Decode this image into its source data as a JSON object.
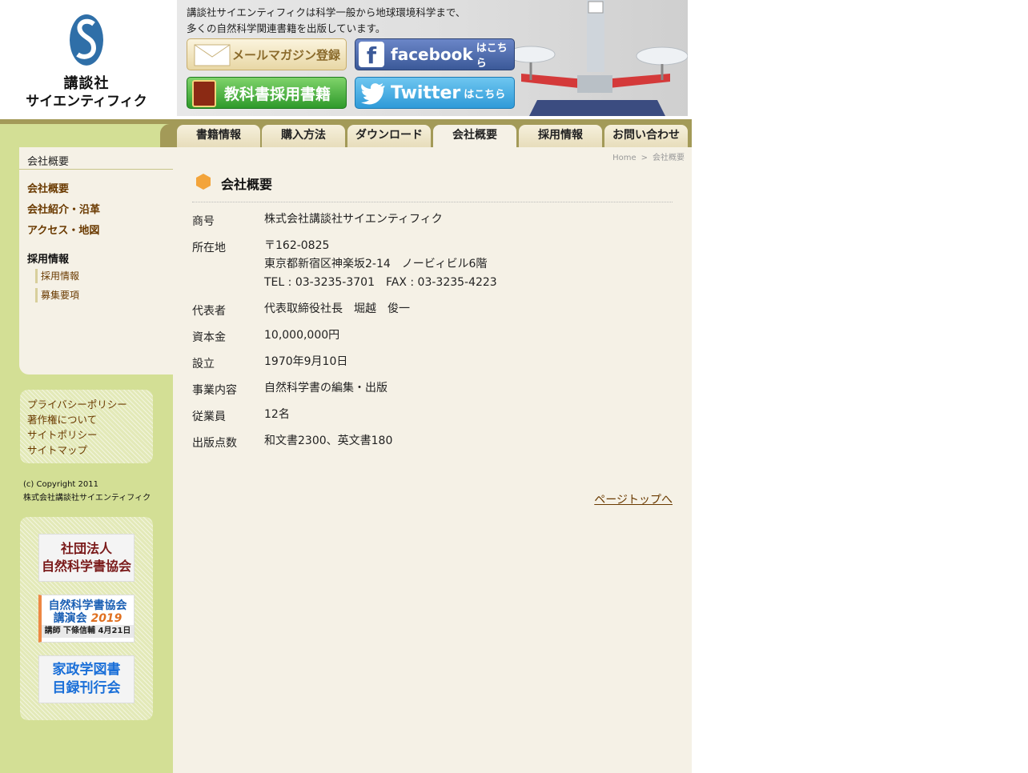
{
  "logo": {
    "line1": "講談社",
    "line2": "サイエンティフィク"
  },
  "banner": {
    "tagline_1": "講談社サイエンティフィクは科学一般から地球環境科学まで、",
    "tagline_2": "多くの自然科学関連書籍を出版しています。",
    "mail_label": "メールマガジン登録",
    "facebook_label": "facebook",
    "facebook_suffix": "はこちら",
    "textbook_label": "教科書採用書籍",
    "twitter_label": "Twitter",
    "twitter_suffix": "はこちら"
  },
  "nav": {
    "tabs": [
      "書籍情報",
      "購入方法",
      "ダウンロード",
      "会社概要",
      "採用情報",
      "お問い合わせ"
    ],
    "active": "会社概要"
  },
  "sidebar": {
    "title": "会社概要",
    "links": [
      "会社概要",
      "会社紹介・沿革",
      "アクセス・地図"
    ],
    "recruit_heading": "採用情報",
    "recruit_links": [
      "採用情報",
      "募集要項"
    ],
    "policy_links": [
      "プライバシーポリシー",
      "著作権について",
      "サイトポリシー",
      "サイトマップ"
    ],
    "copyright_1": "(c) Copyright 2011",
    "copyright_2": "株式会社講談社サイエンティフィク",
    "banners": {
      "assoc1_line1": "社団法人",
      "assoc1_line2": "自然科学書協会",
      "assoc2_line1": "自然科学書協会",
      "assoc2_line2a": "講演会",
      "assoc2_year": "2019",
      "assoc2_line3": "講師 下條信輔 4月21日",
      "assoc3_line1": "家政学図書",
      "assoc3_line2": "目録刊行会"
    }
  },
  "breadcrumb": {
    "home": "Home",
    "sep": ">",
    "current": "会社概要"
  },
  "main": {
    "title": "会社概要",
    "rows": [
      {
        "label": "商号",
        "value": "株式会社講談社サイエンティフィク"
      },
      {
        "label": "所在地",
        "lines": [
          "〒162-0825",
          "東京都新宿区神楽坂2-14　ノービィビル6階",
          "TEL : 03-3235-3701　FAX : 03-3235-4223"
        ]
      },
      {
        "label": "代表者",
        "value": "代表取締役社長　堀越　俊一"
      },
      {
        "label": "資本金",
        "value": "10,000,000円"
      },
      {
        "label": "設立",
        "value": "1970年9月10日"
      },
      {
        "label": "事業内容",
        "value": "自然科学書の編集・出版"
      },
      {
        "label": "従業員",
        "value": "12名"
      },
      {
        "label": "出版点数",
        "value": "和文書2300、英文書180"
      }
    ],
    "page_top": "ページトップへ"
  },
  "colors": {
    "olive": "#a39a58",
    "sidebar_green": "#d3df95",
    "content_bg": "#f5f1e6",
    "link_brown": "#6a3a00",
    "accent_orange": "#f3a43a"
  }
}
